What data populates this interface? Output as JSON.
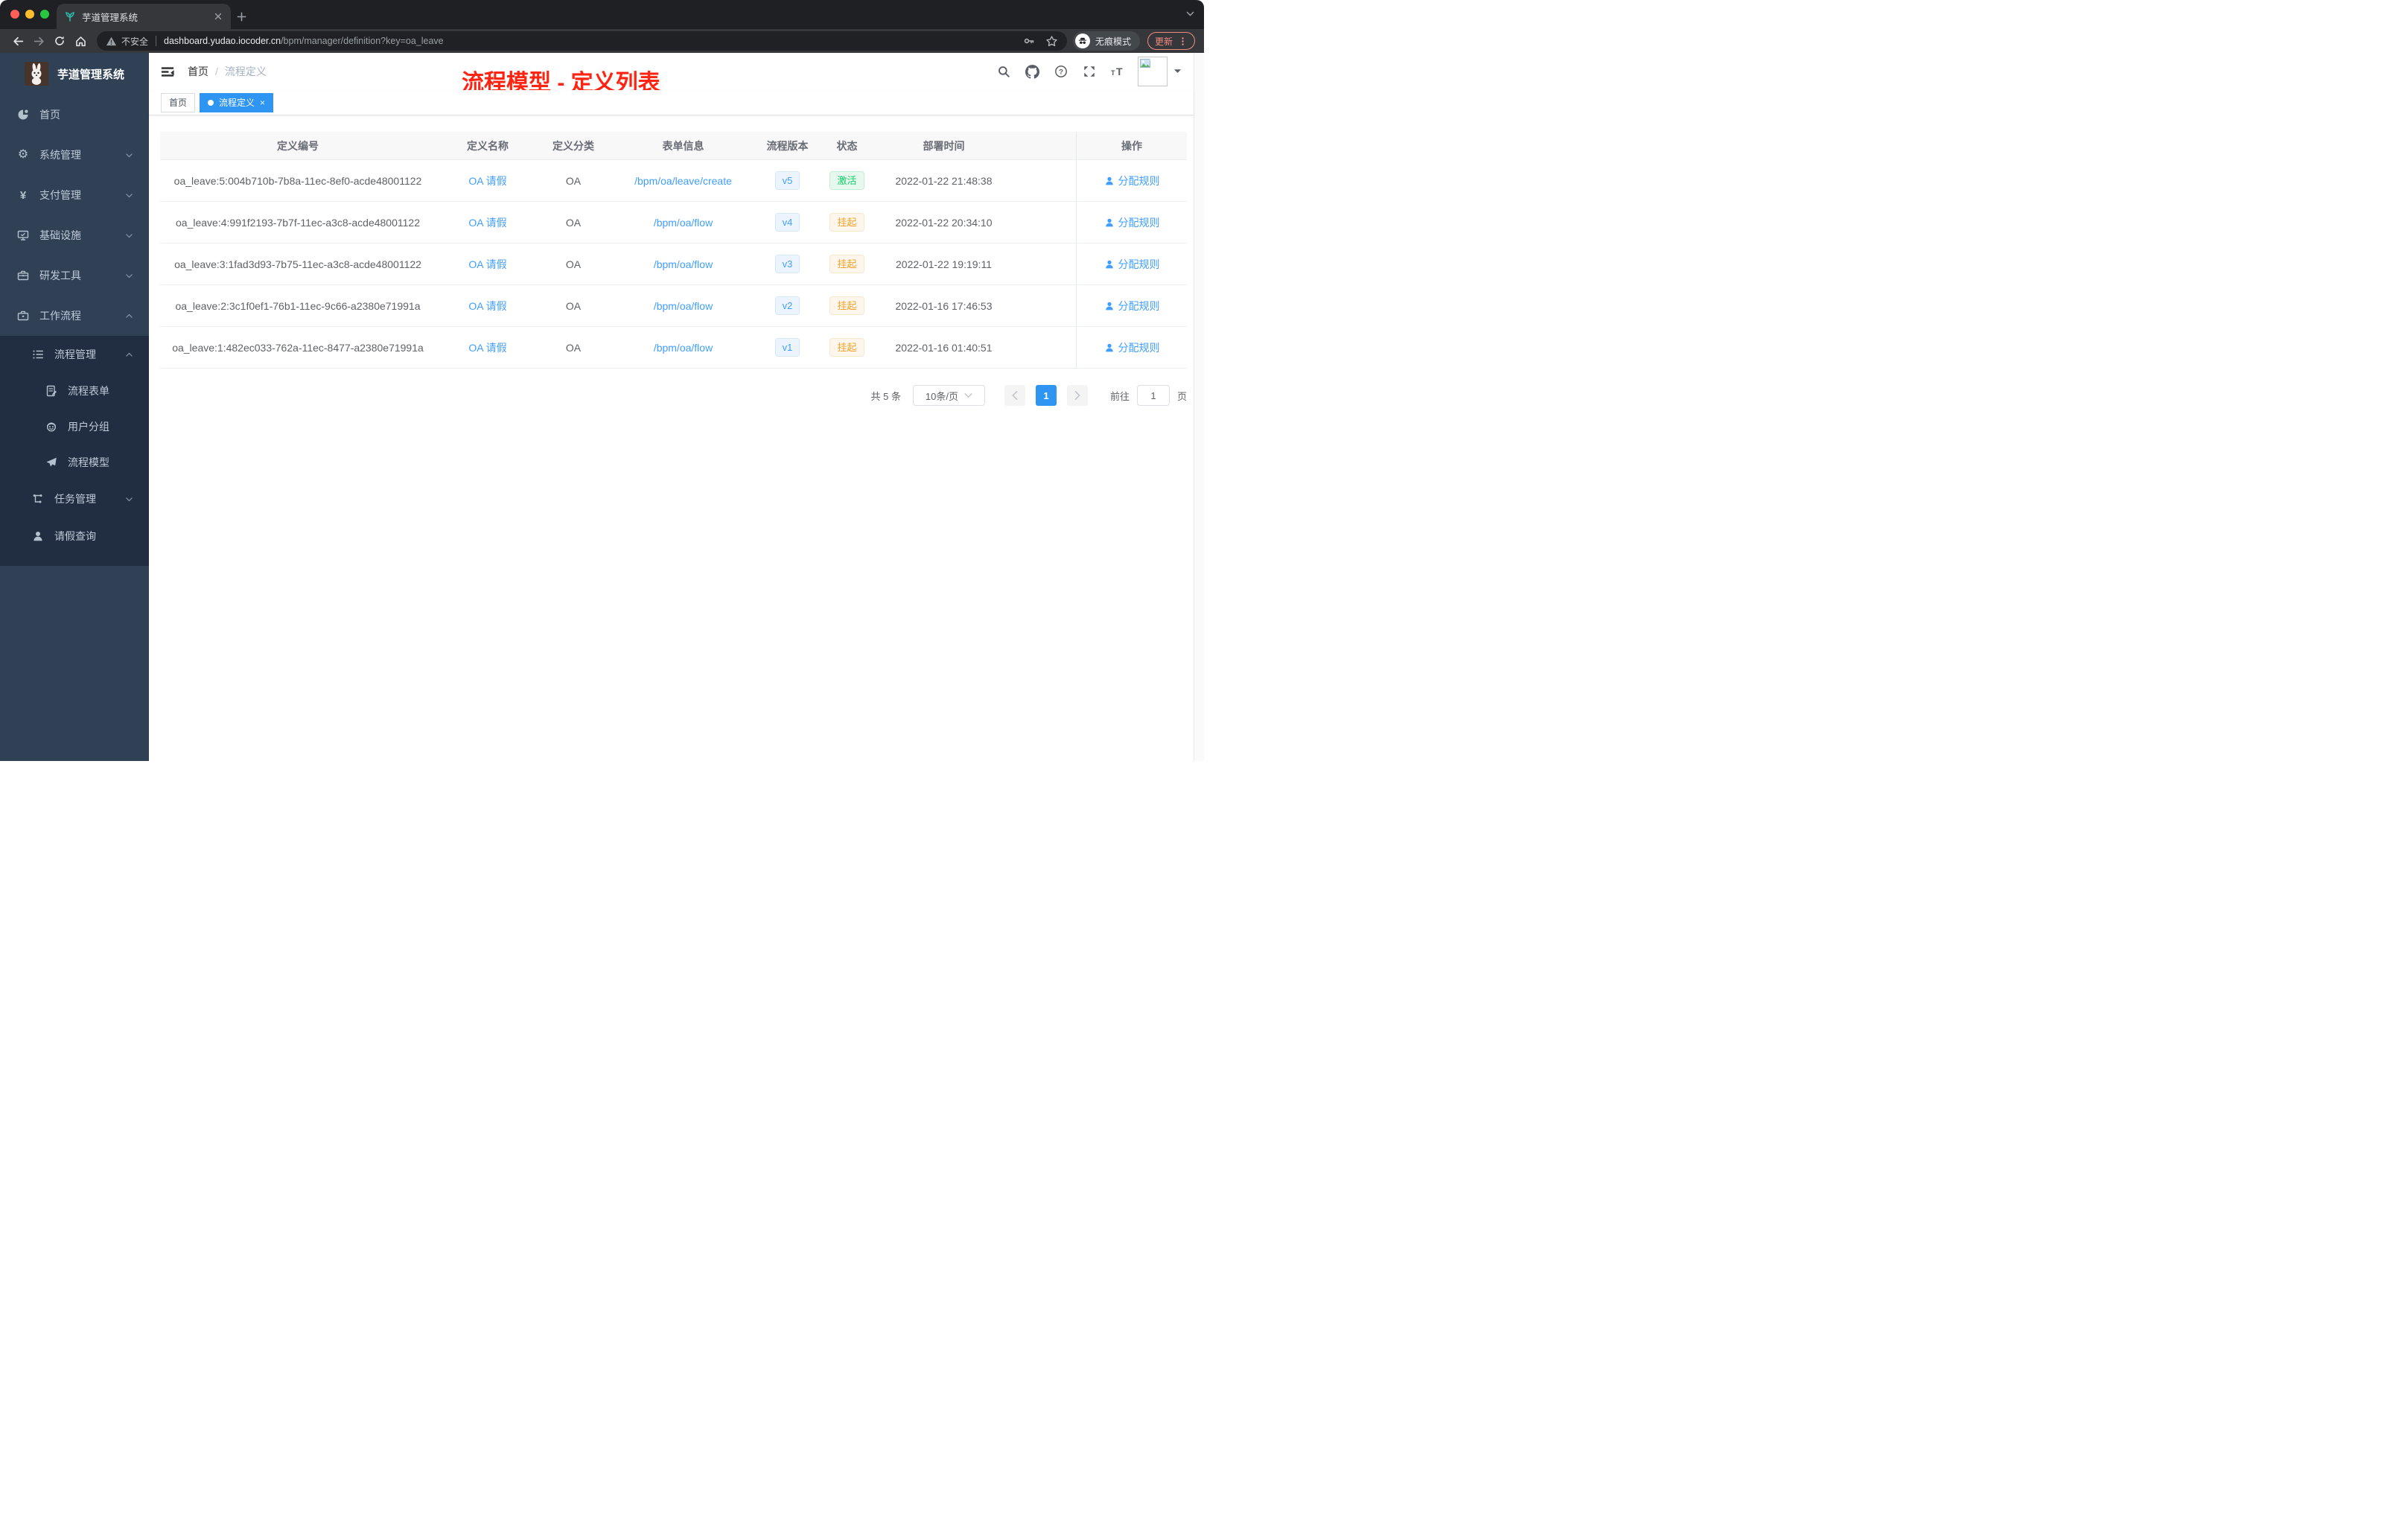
{
  "browser": {
    "tab_title": "芋道管理系统",
    "security_label": "不安全",
    "url_domain": "dashboard.yudao.iocoder.cn",
    "url_path": "/bpm/manager/definition?key=oa_leave",
    "incognito_label": "无痕模式",
    "update_label": "更新"
  },
  "sidebar": {
    "logo_title": "芋道管理系统",
    "menu": [
      {
        "label": "首页",
        "icon": "dashboard-icon",
        "level": 1,
        "arrow": ""
      },
      {
        "label": "系统管理",
        "icon": "gear-icon",
        "level": 1,
        "arrow": "down"
      },
      {
        "label": "支付管理",
        "icon": "yen-icon",
        "level": 1,
        "arrow": "down"
      },
      {
        "label": "基础设施",
        "icon": "monitor-icon",
        "level": 1,
        "arrow": "down"
      },
      {
        "label": "研发工具",
        "icon": "toolbox-icon",
        "level": 1,
        "arrow": "down"
      },
      {
        "label": "工作流程",
        "icon": "briefcase-icon",
        "level": 1,
        "arrow": "up"
      },
      {
        "label": "流程管理",
        "icon": "list-icon",
        "level": 2,
        "arrow": "up"
      },
      {
        "label": "流程表单",
        "icon": "form-icon",
        "level": 3,
        "arrow": ""
      },
      {
        "label": "用户分组",
        "icon": "group-icon",
        "level": 3,
        "arrow": ""
      },
      {
        "label": "流程模型",
        "icon": "send-icon",
        "level": 3,
        "arrow": ""
      },
      {
        "label": "任务管理",
        "icon": "tree-icon",
        "level": 2,
        "arrow": "down"
      },
      {
        "label": "请假查询",
        "icon": "user-icon",
        "level": 2,
        "arrow": ""
      }
    ]
  },
  "header": {
    "breadcrumb": [
      "首页",
      "流程定义"
    ],
    "breadcrumb_separator": "/",
    "annotation": "流程模型 - 定义列表"
  },
  "tags": [
    {
      "label": "首页",
      "active": false
    },
    {
      "label": "流程定义",
      "active": true
    }
  ],
  "table": {
    "columns": [
      "定义编号",
      "定义名称",
      "定义分类",
      "表单信息",
      "流程版本",
      "状态",
      "部署时间",
      "操作"
    ],
    "rows": [
      {
        "id": "oa_leave:5:004b710b-7b8a-11ec-8ef0-acde48001122",
        "name": "OA 请假",
        "category": "OA",
        "form": "/bpm/oa/leave/create",
        "version": "v5",
        "status": "激活",
        "status_type": "success",
        "deploy_time": "2022-01-22 21:48:38",
        "action": "分配规则"
      },
      {
        "id": "oa_leave:4:991f2193-7b7f-11ec-a3c8-acde48001122",
        "name": "OA 请假",
        "category": "OA",
        "form": "/bpm/oa/flow",
        "version": "v4",
        "status": "挂起",
        "status_type": "warning",
        "deploy_time": "2022-01-22 20:34:10",
        "action": "分配规则"
      },
      {
        "id": "oa_leave:3:1fad3d93-7b75-11ec-a3c8-acde48001122",
        "name": "OA 请假",
        "category": "OA",
        "form": "/bpm/oa/flow",
        "version": "v3",
        "status": "挂起",
        "status_type": "warning",
        "deploy_time": "2022-01-22 19:19:11",
        "action": "分配规则"
      },
      {
        "id": "oa_leave:2:3c1f0ef1-76b1-11ec-9c66-a2380e71991a",
        "name": "OA 请假",
        "category": "OA",
        "form": "/bpm/oa/flow",
        "version": "v2",
        "status": "挂起",
        "status_type": "warning",
        "deploy_time": "2022-01-16 17:46:53",
        "action": "分配规则"
      },
      {
        "id": "oa_leave:1:482ec033-762a-11ec-8477-a2380e71991a",
        "name": "OA 请假",
        "category": "OA",
        "form": "/bpm/oa/flow",
        "version": "v1",
        "status": "挂起",
        "status_type": "warning",
        "deploy_time": "2022-01-16 01:40:51",
        "action": "分配规则"
      }
    ]
  },
  "pagination": {
    "total": "共 5 条",
    "page_size": "10条/页",
    "current": "1",
    "goto_label": "前往",
    "goto_value": "1",
    "unit_label": "页"
  },
  "colors": {
    "accent": "#409eff",
    "active_tag": "#2e95f2",
    "success": "#13ce66",
    "warning": "#f0a125",
    "sidebar": "#304156",
    "sidebar_nested": "#212d40",
    "annotation_red": "#ff2412"
  }
}
